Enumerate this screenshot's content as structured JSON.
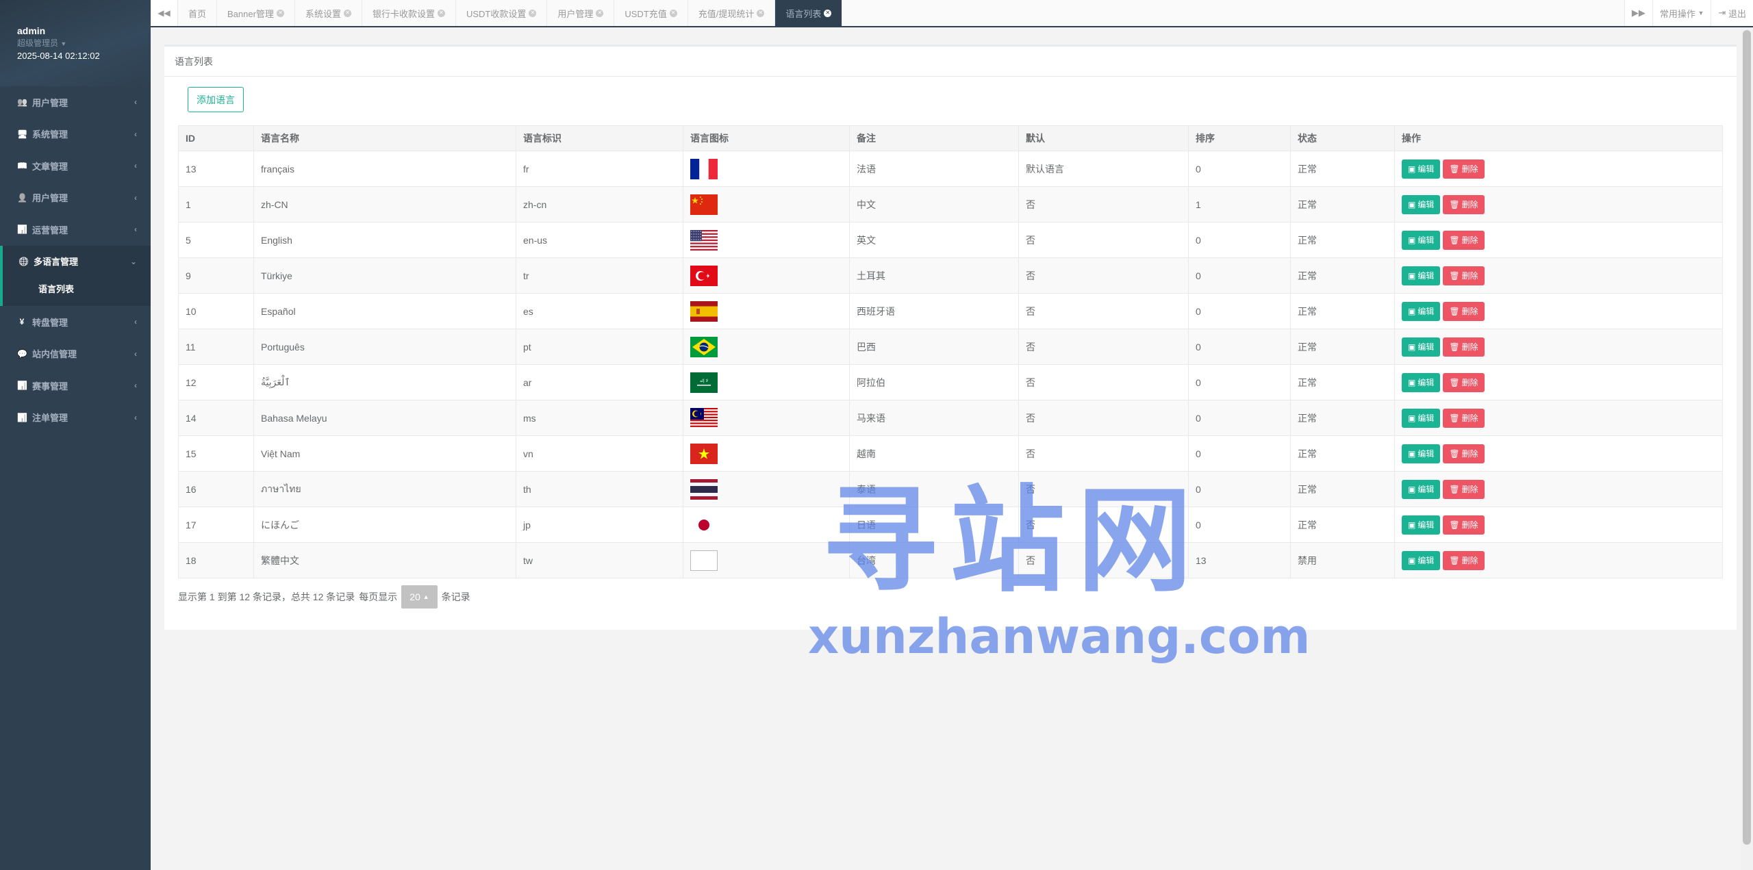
{
  "profile": {
    "name": "admin",
    "role": "超级管理员",
    "datetime": "2025-08-14 02:12:02"
  },
  "sidebar": {
    "items": [
      {
        "label": "用户管理",
        "icon": "users-icon",
        "glyph": "👥"
      },
      {
        "label": "系统管理",
        "icon": "desktop-icon",
        "glyph": "🖥"
      },
      {
        "label": "文章管理",
        "icon": "book-icon",
        "glyph": "📖"
      },
      {
        "label": "用户管理",
        "icon": "user-icon",
        "glyph": "👤"
      },
      {
        "label": "运营管理",
        "icon": "bar-chart-icon",
        "glyph": "📊"
      },
      {
        "label": "多语言管理",
        "icon": "globe-icon",
        "glyph": "🌐",
        "active": true,
        "sub": [
          "语言列表"
        ]
      },
      {
        "label": "转盘管理",
        "icon": "yen-icon",
        "glyph": "¥"
      },
      {
        "label": "站内信管理",
        "icon": "comment-icon",
        "glyph": "💬"
      },
      {
        "label": "赛事管理",
        "icon": "bar-chart-icon",
        "glyph": "📊"
      },
      {
        "label": "注单管理",
        "icon": "bar-chart-icon",
        "glyph": "📊"
      }
    ]
  },
  "tabs": [
    "首页",
    "Banner管理",
    "系统设置",
    "银行卡收款设置",
    "USDT收款设置",
    "用户管理",
    "USDT充值",
    "充值/提现统计",
    "语言列表"
  ],
  "active_tab": 8,
  "tab_right": {
    "common_ops": "常用操作",
    "logout": "退出"
  },
  "panel": {
    "title": "语言列表",
    "add_button": "添加语言"
  },
  "table": {
    "headers": [
      "ID",
      "语言名称",
      "语言标识",
      "语言图标",
      "备注",
      "默认",
      "排序",
      "状态",
      "操作"
    ],
    "rows": [
      {
        "id": "13",
        "name": "français",
        "code": "fr",
        "flag": "fr",
        "note": "法语",
        "default": "默认语言",
        "sort": "0",
        "status": "正常"
      },
      {
        "id": "1",
        "name": "zh-CN",
        "code": "zh-cn",
        "flag": "cn",
        "note": "中文",
        "default": "否",
        "sort": "1",
        "status": "正常"
      },
      {
        "id": "5",
        "name": "English",
        "code": "en-us",
        "flag": "us",
        "note": "英文",
        "default": "否",
        "sort": "0",
        "status": "正常"
      },
      {
        "id": "9",
        "name": "Türkiye",
        "code": "tr",
        "flag": "tr",
        "note": "土耳其",
        "default": "否",
        "sort": "0",
        "status": "正常"
      },
      {
        "id": "10",
        "name": "Español",
        "code": "es",
        "flag": "es",
        "note": "西班牙语",
        "default": "否",
        "sort": "0",
        "status": "正常"
      },
      {
        "id": "11",
        "name": "Português",
        "code": "pt",
        "flag": "br",
        "note": "巴西",
        "default": "否",
        "sort": "0",
        "status": "正常"
      },
      {
        "id": "12",
        "name": "ٱلْعَرَبِيَّةُ",
        "code": "ar",
        "flag": "sa",
        "note": "阿拉伯",
        "default": "否",
        "sort": "0",
        "status": "正常"
      },
      {
        "id": "14",
        "name": "Bahasa Melayu",
        "code": "ms",
        "flag": "my",
        "note": "马来语",
        "default": "否",
        "sort": "0",
        "status": "正常"
      },
      {
        "id": "15",
        "name": "Việt Nam",
        "code": "vn",
        "flag": "vn",
        "note": "越南",
        "default": "否",
        "sort": "0",
        "status": "正常"
      },
      {
        "id": "16",
        "name": "ภาษาไทย",
        "code": "th",
        "flag": "th",
        "note": "泰语",
        "default": "否",
        "sort": "0",
        "status": "正常"
      },
      {
        "id": "17",
        "name": "にほんご",
        "code": "jp",
        "flag": "jp",
        "note": "日语",
        "default": "否",
        "sort": "0",
        "status": "正常"
      },
      {
        "id": "18",
        "name": "繁體中文",
        "code": "tw",
        "flag": "broken",
        "note": "台湾",
        "default": "否",
        "sort": "13",
        "status": "禁用"
      }
    ],
    "edit_label": "编辑",
    "delete_label": "删除"
  },
  "pager": {
    "summary": "显示第 1 到第 12 条记录，总共 12 条记录",
    "per_page_prefix": "每页显示",
    "per_page_value": "20",
    "per_page_suffix": "条记录"
  },
  "watermark": {
    "big": "寻站网",
    "small": "xunzhanwang.com"
  },
  "colors": {
    "sidebar_bg": "#2f4050",
    "primary": "#1ab394",
    "danger": "#ed5565"
  }
}
